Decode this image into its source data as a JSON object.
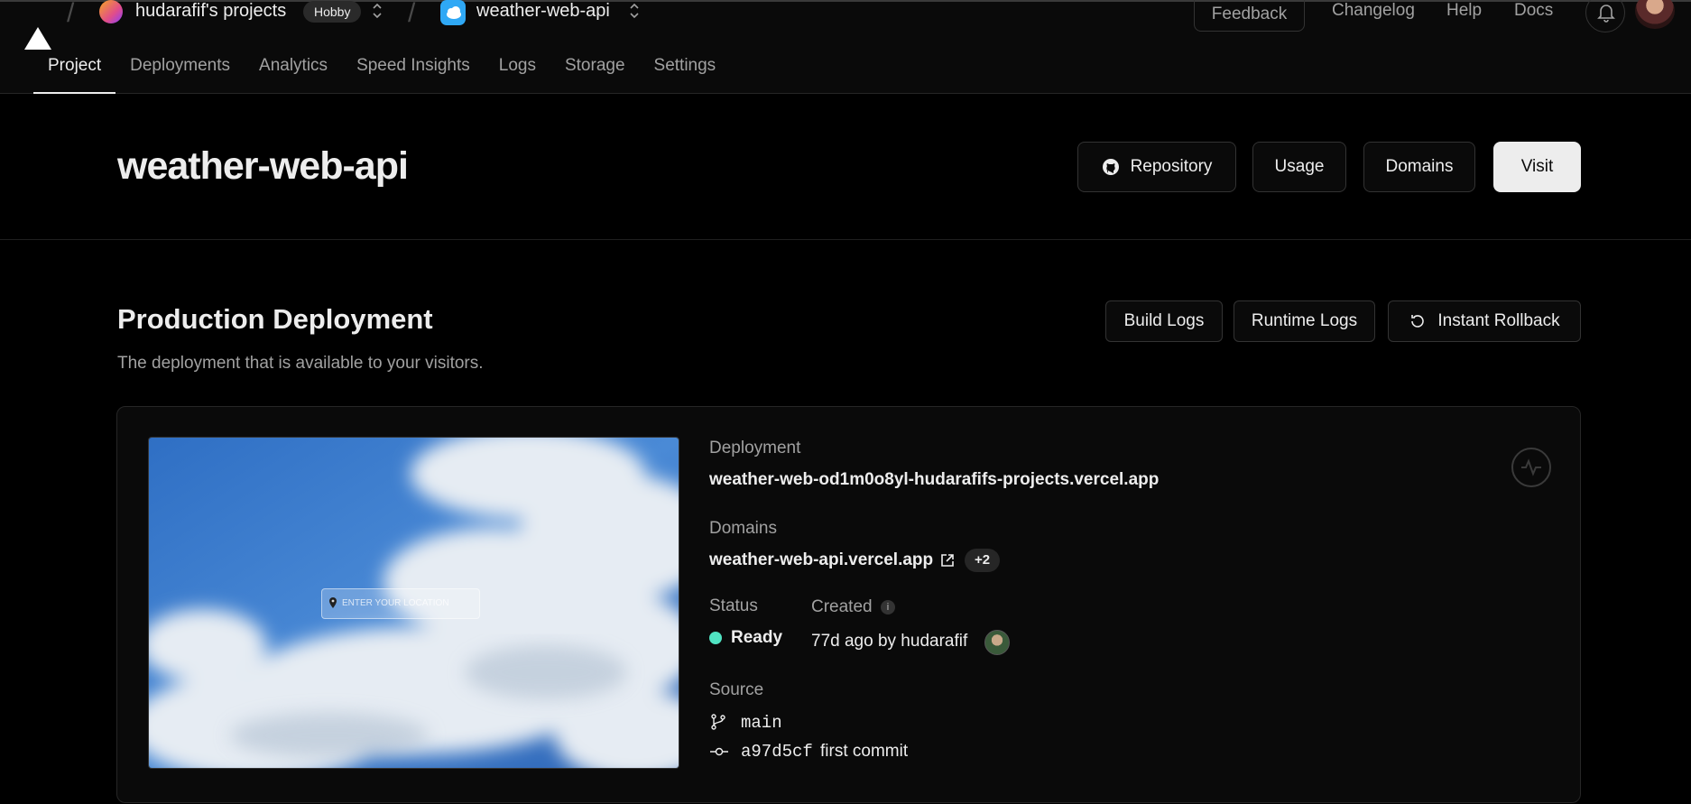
{
  "topbar": {
    "team_name": "hudarafif's projects",
    "plan_badge": "Hobby",
    "project_name": "weather-web-api",
    "feedback": "Feedback",
    "links": [
      "Changelog",
      "Help",
      "Docs"
    ]
  },
  "tabs": [
    "Project",
    "Deployments",
    "Analytics",
    "Speed Insights",
    "Logs",
    "Storage",
    "Settings"
  ],
  "header": {
    "title": "weather-web-api",
    "buttons": {
      "repository": "Repository",
      "usage": "Usage",
      "domains": "Domains",
      "visit": "Visit"
    }
  },
  "production": {
    "title": "Production Deployment",
    "subtitle": "The deployment that is available to your visitors.",
    "buttons": {
      "build_logs": "Build Logs",
      "runtime_logs": "Runtime Logs",
      "rollback": "Instant Rollback"
    },
    "preview_placeholder": "ENTER YOUR LOCATION",
    "deployment_label": "Deployment",
    "deployment_url": "weather-web-od1m0o8yl-hudarafifs-projects.vercel.app",
    "domains_label": "Domains",
    "domain": "weather-web-api.vercel.app",
    "domains_extra": "+2",
    "status_label": "Status",
    "status": "Ready",
    "created_label": "Created",
    "created_info": "i",
    "created": "77d ago by hudarafif",
    "source_label": "Source",
    "branch": "main",
    "commit_hash": "a97d5cf",
    "commit_message": "first commit"
  },
  "colors": {
    "status_ready": "#50e3c2",
    "accent": "#ededed",
    "background": "#000000"
  }
}
